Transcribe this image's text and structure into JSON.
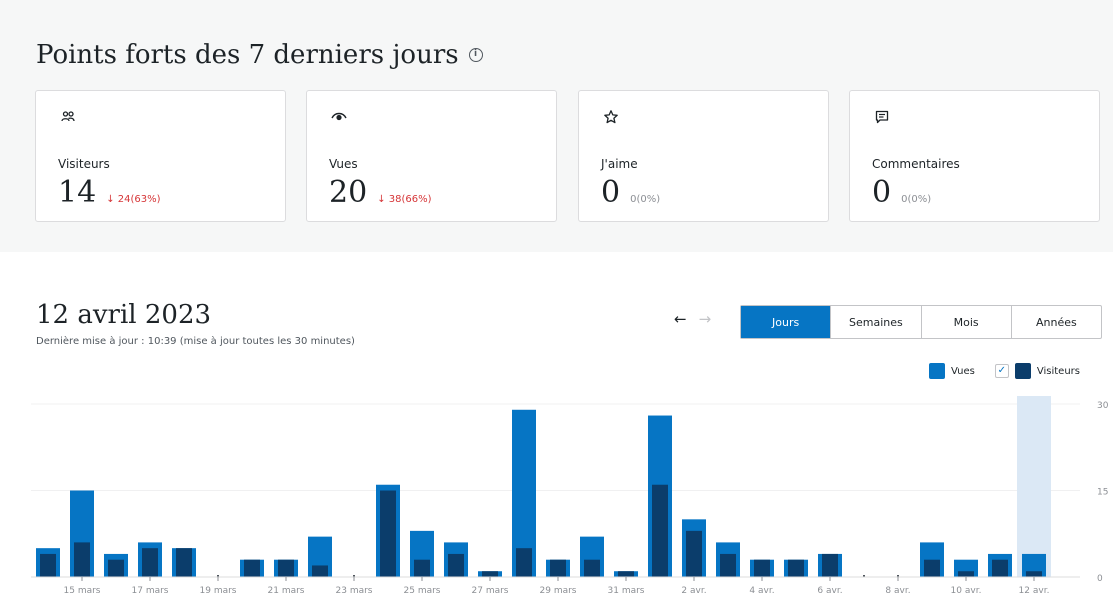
{
  "highlights": {
    "title": "Points forts des 7 derniers jours",
    "info_glyph": "i",
    "cards": [
      {
        "icon": "people-icon",
        "label": "Visiteurs",
        "value": "14",
        "delta": "↓ 24(63%)",
        "delta_color": "#d63638"
      },
      {
        "icon": "eye-icon",
        "label": "Vues",
        "value": "20",
        "delta": "↓ 38(66%)",
        "delta_color": "#d63638"
      },
      {
        "icon": "star-icon",
        "label": "J'aime",
        "value": "0",
        "delta": "0(0%)",
        "delta_color": "#8c8f94"
      },
      {
        "icon": "comment-icon",
        "label": "Commentaires",
        "value": "0",
        "delta": "0(0%)",
        "delta_color": "#8c8f94"
      }
    ]
  },
  "stats": {
    "date_title": "12 avril 2023",
    "updated": "Dernière mise à jour : 10:39 (mise à jour toutes les 30 minutes)",
    "nav": {
      "prev": "←",
      "next": "→"
    },
    "tabs": [
      "Jours",
      "Semaines",
      "Mois",
      "Années"
    ],
    "active_tab": "Jours",
    "legend": {
      "views_label": "Vues",
      "visitors_label": "Visiteurs",
      "visitors_checked": "✓"
    },
    "colors": {
      "views": "#0675c4",
      "visitors": "#0b3d6b",
      "highlight": "#dbe8f5",
      "accent": "#0675c4"
    }
  },
  "chart_data": {
    "type": "bar",
    "categories": [
      "14 mars",
      "15 mars",
      "16 mars",
      "17 mars",
      "18 mars",
      "19 mars",
      "20 mars",
      "21 mars",
      "22 mars",
      "23 mars",
      "24 mars",
      "25 mars",
      "26 mars",
      "27 mars",
      "28 mars",
      "29 mars",
      "30 mars",
      "31 mars",
      "1 avr.",
      "2 avr.",
      "3 avr.",
      "4 avr.",
      "5 avr.",
      "6 avr.",
      "7 avr.",
      "8 avr.",
      "9 avr.",
      "10 avr.",
      "11 avr.",
      "12 avr."
    ],
    "tick_labels": [
      "15 mars",
      "17 mars",
      "19 mars",
      "21 mars",
      "23 mars",
      "25 mars",
      "27 mars",
      "29 mars",
      "31 mars",
      "2 avr.",
      "4 avr.",
      "6 avr.",
      "8 avr.",
      "10 avr.",
      "12 avr."
    ],
    "series": [
      {
        "name": "Vues",
        "values": [
          5,
          15,
          4,
          6,
          5,
          0,
          3,
          3,
          7,
          0,
          16,
          8,
          6,
          1,
          29,
          3,
          7,
          1,
          28,
          10,
          6,
          3,
          3,
          4,
          0,
          0,
          6,
          3,
          4,
          4
        ]
      },
      {
        "name": "Visiteurs",
        "values": [
          4,
          6,
          3,
          5,
          5,
          0,
          3,
          3,
          2,
          0,
          15,
          3,
          4,
          1,
          5,
          3,
          3,
          1,
          16,
          8,
          4,
          3,
          3,
          4,
          0,
          0,
          3,
          1,
          3,
          1
        ]
      }
    ],
    "y_ticks": [
      "0",
      "15",
      "30"
    ],
    "ylim": [
      0,
      30
    ],
    "highlighted_category": "12 avr."
  }
}
